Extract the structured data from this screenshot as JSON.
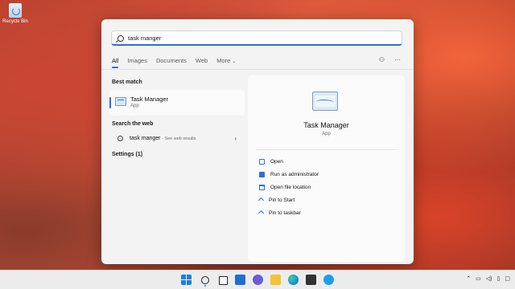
{
  "desktop": {
    "recycle_bin_label": "Recycle Bin"
  },
  "search": {
    "value": "task manger"
  },
  "tabs": [
    {
      "label": "All",
      "active": true
    },
    {
      "label": "Images"
    },
    {
      "label": "Documents"
    },
    {
      "label": "Web"
    },
    {
      "label": "More"
    }
  ],
  "top_icons": [
    "share-icon",
    "more-options-icon"
  ],
  "best_match": {
    "heading": "Best match",
    "title": "Task Manager",
    "subtitle": "App",
    "icon": "task-manager-icon"
  },
  "search_web": {
    "heading": "Search the web",
    "query": "task manger",
    "hint": " - See web results"
  },
  "settings": {
    "heading": "Settings (1)"
  },
  "preview": {
    "title": "Task Manager",
    "subtitle": "App",
    "actions": [
      {
        "label": "Open",
        "icon": "open-icon"
      },
      {
        "label": "Run as administrator",
        "icon": "shield-icon"
      },
      {
        "label": "Open file location",
        "icon": "folder-icon"
      },
      {
        "label": "Pin to Start",
        "icon": "pin-icon"
      },
      {
        "label": "Pin to taskbar",
        "icon": "pin-icon"
      }
    ]
  },
  "taskbar": {
    "apps": [
      "start-icon",
      "search-icon",
      "task-view-icon",
      "widgets-icon",
      "chat-icon",
      "file-explorer-icon",
      "edge-icon",
      "store-icon",
      "skype-icon"
    ],
    "tray": [
      "chevron-up-icon",
      "network-icon",
      "volume-icon",
      "battery-icon",
      "notification-icon"
    ]
  },
  "colors": {
    "accent": "#2d6fd4"
  }
}
